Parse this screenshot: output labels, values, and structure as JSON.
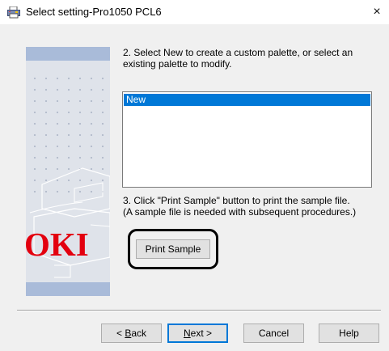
{
  "window": {
    "title": "Select setting-Pro1050 PCL6",
    "close_glyph": "×"
  },
  "side_panel": {
    "logo_text": "OKI",
    "logo_color": "#e3000f"
  },
  "step2": {
    "line1": "2. Select New to create a custom palette, or select an",
    "line2": "existing palette to modify."
  },
  "palette_list": {
    "items": [
      "New"
    ],
    "selected_index": 0
  },
  "step3": {
    "line1": "3. Click \"Print Sample\" button to print the sample file.",
    "line2": "(A sample file is needed with subsequent procedures.)"
  },
  "print_sample_button": {
    "label": "Print Sample"
  },
  "footer_buttons": {
    "back": {
      "prefix": "< ",
      "accel": "B",
      "rest": "ack"
    },
    "next": {
      "accel": "N",
      "rest": "ext >"
    },
    "cancel": "Cancel",
    "help": "Help"
  },
  "colors": {
    "selection": "#0078d7",
    "panel_band": "#a9bbd9",
    "dialog_bg": "#f0f0f0"
  }
}
